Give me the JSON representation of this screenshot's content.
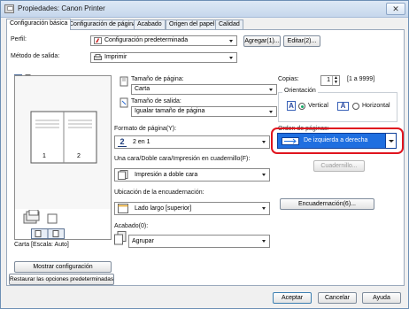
{
  "window": {
    "title": "Propiedades: Canon Printer",
    "close_glyph": "✕"
  },
  "tabs": [
    {
      "label": "Configuración básica"
    },
    {
      "label": "Configuración de página"
    },
    {
      "label": "Acabado"
    },
    {
      "label": "Origen del papel"
    },
    {
      "label": "Calidad"
    }
  ],
  "profile": {
    "label": "Perfil:",
    "value": "Configuración predeterminada",
    "add_button": "Agregar(1)...",
    "edit_button": "Editar(2)..."
  },
  "output_method": {
    "label": "Método de salida:",
    "value": "Imprimir"
  },
  "preview": {
    "caption": "Carta [Escala: Auto]",
    "page_numbers": [
      "1",
      "2"
    ]
  },
  "page_size": {
    "label": "Tamaño de página:",
    "value": "Carta"
  },
  "output_size": {
    "label": "Tamaño de salida:",
    "value": "Igualar tamaño de página"
  },
  "copies": {
    "label": "Copias:",
    "value": "1",
    "range": "[1 a 9999]"
  },
  "orientation": {
    "label": "Orientación",
    "options": [
      "Vertical",
      "Horizontal"
    ],
    "selected": "Vertical",
    "icon_letter": "A"
  },
  "page_layout": {
    "label": "Formato de página(Y):",
    "value": "2 en 1",
    "icon_number": "2"
  },
  "page_order": {
    "label": "Orden de páginas:",
    "value": "De izquierda a derecha",
    "highlight_color": "#e0141e",
    "accent_color": "#1f6fe0"
  },
  "duplex": {
    "label": "Una cara/Doble cara/Impresión en cuadernillo(F):",
    "value": "Impresión a doble cara"
  },
  "booklet_button": "Cuadernillo...",
  "binding_location": {
    "label": "Ubicación de la encuadernación:",
    "value": "Lado largo [superior]"
  },
  "binding_button": "Encuadernación(6)...",
  "finishing": {
    "label": "Acabado(0):",
    "value": "Agrupar"
  },
  "show_settings_button": "Mostrar configuración",
  "restore_defaults_button": "Restaurar las opciones predeterminadas",
  "footer": {
    "ok": "Aceptar",
    "cancel": "Cancelar",
    "help": "Ayuda"
  }
}
